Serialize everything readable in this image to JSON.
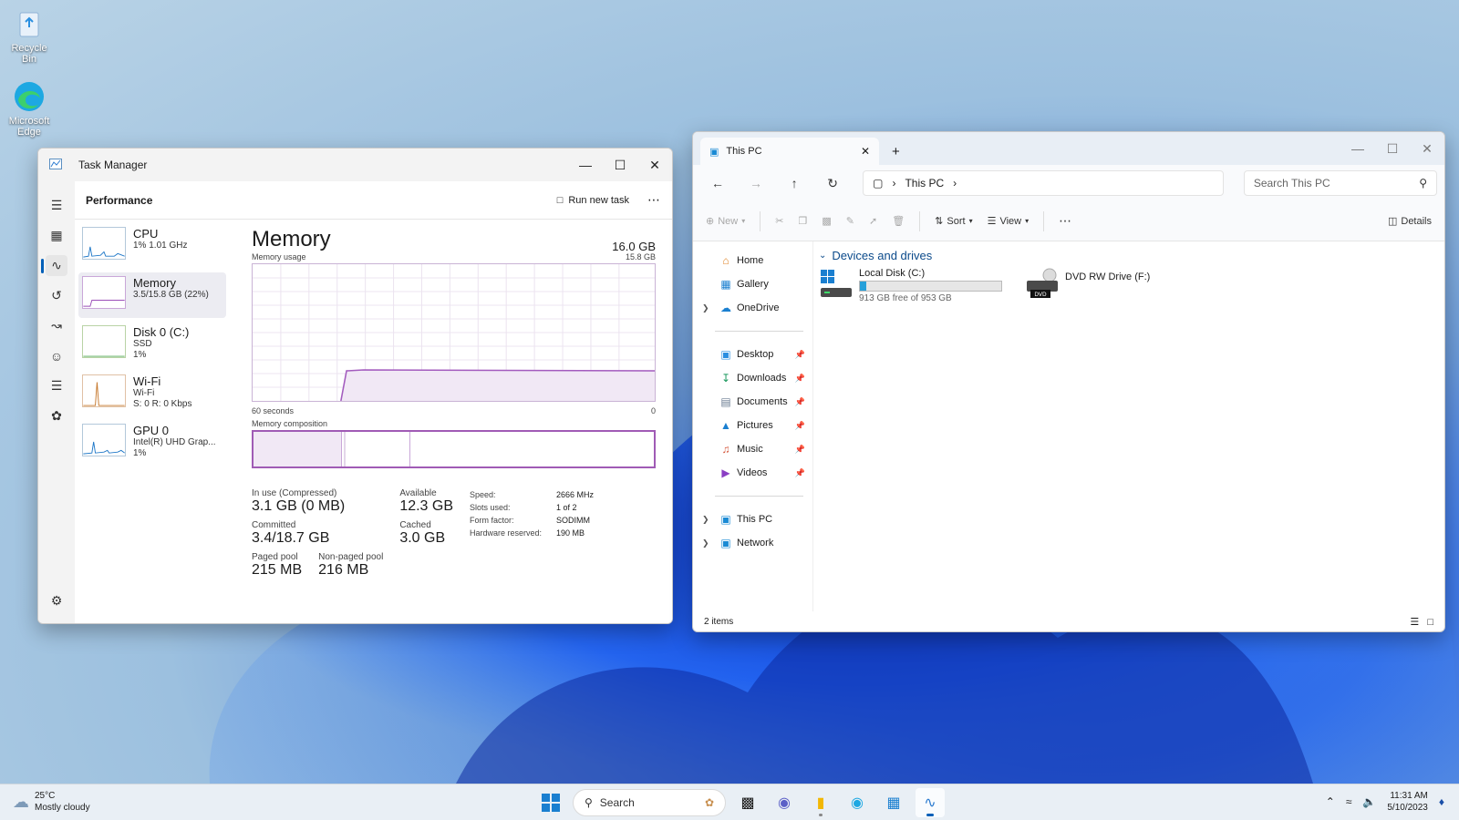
{
  "desktop": {
    "icons": [
      {
        "label": "Recycle Bin"
      },
      {
        "label": "Microsoft Edge"
      }
    ]
  },
  "task_manager": {
    "title": "Task Manager",
    "page_title": "Performance",
    "run_new_task": "Run new task",
    "perf_items": [
      {
        "name": "CPU",
        "sub1": "1% 1.01 GHz",
        "sub2": ""
      },
      {
        "name": "Memory",
        "sub1": "3.5/15.8 GB (22%)",
        "sub2": ""
      },
      {
        "name": "Disk 0 (C:)",
        "sub1": "SSD",
        "sub2": "1%"
      },
      {
        "name": "Wi-Fi",
        "sub1": "Wi-Fi",
        "sub2": "S: 0 R: 0 Kbps"
      },
      {
        "name": "GPU 0",
        "sub1": "Intel(R) UHD Grap...",
        "sub2": "1%"
      }
    ],
    "detail": {
      "heading": "Memory",
      "total": "16.0 GB",
      "usage_label": "Memory usage",
      "usage_max": "15.8 GB",
      "time_left": "60 seconds",
      "time_right": "0",
      "composition_label": "Memory composition",
      "in_use_fraction": 0.22,
      "stats": {
        "in_use_label": "In use (Compressed)",
        "in_use": "3.1 GB (0 MB)",
        "available_label": "Available",
        "available": "12.3 GB",
        "committed_label": "Committed",
        "committed": "3.4/18.7 GB",
        "cached_label": "Cached",
        "cached": "3.0 GB",
        "paged_label": "Paged pool",
        "paged": "215 MB",
        "nonpaged_label": "Non-paged pool",
        "nonpaged": "216 MB"
      },
      "hardware": [
        {
          "k": "Speed:",
          "v": "2666 MHz"
        },
        {
          "k": "Slots used:",
          "v": "1 of 2"
        },
        {
          "k": "Form factor:",
          "v": "SODIMM"
        },
        {
          "k": "Hardware reserved:",
          "v": "190 MB"
        }
      ]
    }
  },
  "explorer": {
    "tab_title": "This PC",
    "breadcrumb": "This PC",
    "search_placeholder": "Search This PC",
    "cmd": {
      "new": "New",
      "sort": "Sort",
      "view": "View",
      "details": "Details"
    },
    "sidebar": {
      "quick": [
        {
          "label": "Home"
        },
        {
          "label": "Gallery"
        },
        {
          "label": "OneDrive"
        }
      ],
      "pinned": [
        {
          "label": "Desktop"
        },
        {
          "label": "Downloads"
        },
        {
          "label": "Documents"
        },
        {
          "label": "Pictures"
        },
        {
          "label": "Music"
        },
        {
          "label": "Videos"
        }
      ],
      "bottom": [
        {
          "label": "This PC"
        },
        {
          "label": "Network"
        }
      ]
    },
    "group": "Devices and drives",
    "drives": [
      {
        "name": "Local Disk (C:)",
        "free": "913 GB free of 953 GB",
        "used_fraction": 0.042
      },
      {
        "name": "DVD RW Drive (F:)",
        "badge": "DVD"
      }
    ],
    "status": "2 items"
  },
  "taskbar": {
    "weather_temp": "25°C",
    "weather_desc": "Mostly cloudy",
    "search_label": "Search",
    "time": "11:31 AM",
    "date": "5/10/2023"
  }
}
